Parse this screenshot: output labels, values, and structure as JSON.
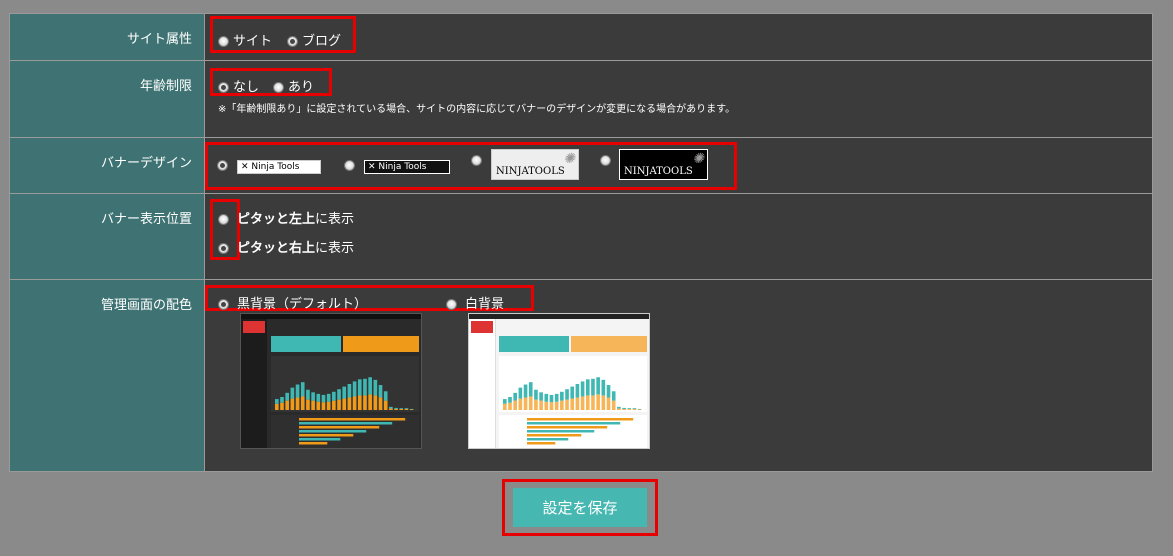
{
  "rows": {
    "site_attr": {
      "label": "サイト属性",
      "options": [
        {
          "label": "サイト",
          "checked": false
        },
        {
          "label": "ブログ",
          "checked": true
        }
      ]
    },
    "age": {
      "label": "年齢制限",
      "options": [
        {
          "label": "なし",
          "checked": true
        },
        {
          "label": "あり",
          "checked": false
        }
      ],
      "note": "※「年齢制限あり」に設定されている場合、サイトの内容に応じてバナーのデザインが変更になる場合があります。"
    },
    "banner": {
      "label": "バナーデザイン",
      "small_text": "Ninja Tools",
      "big_text": "NINJATOOLS",
      "selected_index": 0
    },
    "position": {
      "label": "バナー表示位置",
      "options": [
        {
          "bold": "ピタッと左上",
          "rest": "に表示",
          "checked": false
        },
        {
          "bold": "ピタッと右上",
          "rest": "に表示",
          "checked": true
        }
      ]
    },
    "theme": {
      "label": "管理画面の配色",
      "options": [
        {
          "label": "黒背景（デフォルト）",
          "checked": true
        },
        {
          "label": "白背景",
          "checked": false
        }
      ]
    }
  },
  "save_label": "設定を保存",
  "colors": {
    "page_bg": "#8a8a8a",
    "label_bg": "#3f7373",
    "value_bg": "#3b3b3b",
    "highlight": "#e60000",
    "save_button": "#47b7b2",
    "chart_teal": "#3fb8b4",
    "chart_orange": "#f09a1a"
  },
  "preview_chart": {
    "values_teal": [
      18,
      22,
      30,
      42,
      50,
      55,
      38,
      32,
      30,
      28,
      30,
      34,
      40,
      46,
      52,
      58,
      62,
      64,
      66,
      60,
      48,
      36,
      6,
      4,
      3,
      3,
      2
    ],
    "values_orange": [
      12,
      14,
      18,
      22,
      24,
      26,
      20,
      18,
      16,
      15,
      16,
      18,
      20,
      22,
      24,
      26,
      28,
      28,
      30,
      28,
      24,
      18,
      3,
      2,
      2,
      2,
      1
    ]
  }
}
